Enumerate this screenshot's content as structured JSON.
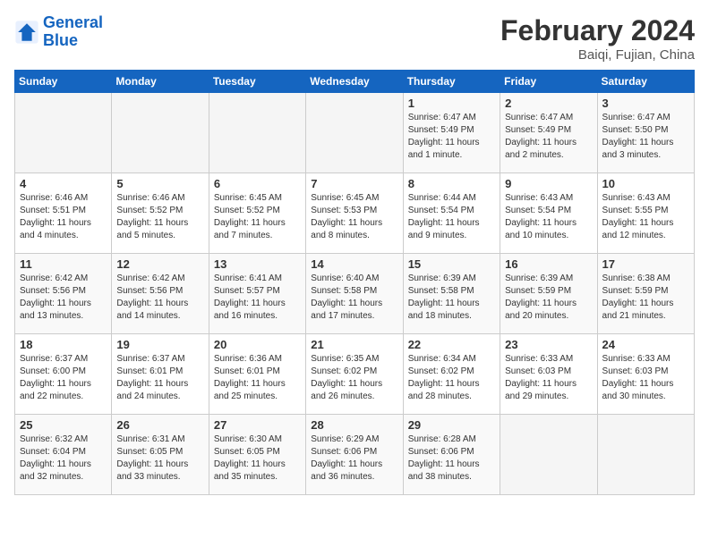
{
  "header": {
    "logo_line1": "General",
    "logo_line2": "Blue",
    "month_year": "February 2024",
    "location": "Baiqi, Fujian, China"
  },
  "days_of_week": [
    "Sunday",
    "Monday",
    "Tuesday",
    "Wednesday",
    "Thursday",
    "Friday",
    "Saturday"
  ],
  "weeks": [
    [
      {
        "day": "",
        "info": ""
      },
      {
        "day": "",
        "info": ""
      },
      {
        "day": "",
        "info": ""
      },
      {
        "day": "",
        "info": ""
      },
      {
        "day": "1",
        "info": "Sunrise: 6:47 AM\nSunset: 5:49 PM\nDaylight: 11 hours\nand 1 minute."
      },
      {
        "day": "2",
        "info": "Sunrise: 6:47 AM\nSunset: 5:49 PM\nDaylight: 11 hours\nand 2 minutes."
      },
      {
        "day": "3",
        "info": "Sunrise: 6:47 AM\nSunset: 5:50 PM\nDaylight: 11 hours\nand 3 minutes."
      }
    ],
    [
      {
        "day": "4",
        "info": "Sunrise: 6:46 AM\nSunset: 5:51 PM\nDaylight: 11 hours\nand 4 minutes."
      },
      {
        "day": "5",
        "info": "Sunrise: 6:46 AM\nSunset: 5:52 PM\nDaylight: 11 hours\nand 5 minutes."
      },
      {
        "day": "6",
        "info": "Sunrise: 6:45 AM\nSunset: 5:52 PM\nDaylight: 11 hours\nand 7 minutes."
      },
      {
        "day": "7",
        "info": "Sunrise: 6:45 AM\nSunset: 5:53 PM\nDaylight: 11 hours\nand 8 minutes."
      },
      {
        "day": "8",
        "info": "Sunrise: 6:44 AM\nSunset: 5:54 PM\nDaylight: 11 hours\nand 9 minutes."
      },
      {
        "day": "9",
        "info": "Sunrise: 6:43 AM\nSunset: 5:54 PM\nDaylight: 11 hours\nand 10 minutes."
      },
      {
        "day": "10",
        "info": "Sunrise: 6:43 AM\nSunset: 5:55 PM\nDaylight: 11 hours\nand 12 minutes."
      }
    ],
    [
      {
        "day": "11",
        "info": "Sunrise: 6:42 AM\nSunset: 5:56 PM\nDaylight: 11 hours\nand 13 minutes."
      },
      {
        "day": "12",
        "info": "Sunrise: 6:42 AM\nSunset: 5:56 PM\nDaylight: 11 hours\nand 14 minutes."
      },
      {
        "day": "13",
        "info": "Sunrise: 6:41 AM\nSunset: 5:57 PM\nDaylight: 11 hours\nand 16 minutes."
      },
      {
        "day": "14",
        "info": "Sunrise: 6:40 AM\nSunset: 5:58 PM\nDaylight: 11 hours\nand 17 minutes."
      },
      {
        "day": "15",
        "info": "Sunrise: 6:39 AM\nSunset: 5:58 PM\nDaylight: 11 hours\nand 18 minutes."
      },
      {
        "day": "16",
        "info": "Sunrise: 6:39 AM\nSunset: 5:59 PM\nDaylight: 11 hours\nand 20 minutes."
      },
      {
        "day": "17",
        "info": "Sunrise: 6:38 AM\nSunset: 5:59 PM\nDaylight: 11 hours\nand 21 minutes."
      }
    ],
    [
      {
        "day": "18",
        "info": "Sunrise: 6:37 AM\nSunset: 6:00 PM\nDaylight: 11 hours\nand 22 minutes."
      },
      {
        "day": "19",
        "info": "Sunrise: 6:37 AM\nSunset: 6:01 PM\nDaylight: 11 hours\nand 24 minutes."
      },
      {
        "day": "20",
        "info": "Sunrise: 6:36 AM\nSunset: 6:01 PM\nDaylight: 11 hours\nand 25 minutes."
      },
      {
        "day": "21",
        "info": "Sunrise: 6:35 AM\nSunset: 6:02 PM\nDaylight: 11 hours\nand 26 minutes."
      },
      {
        "day": "22",
        "info": "Sunrise: 6:34 AM\nSunset: 6:02 PM\nDaylight: 11 hours\nand 28 minutes."
      },
      {
        "day": "23",
        "info": "Sunrise: 6:33 AM\nSunset: 6:03 PM\nDaylight: 11 hours\nand 29 minutes."
      },
      {
        "day": "24",
        "info": "Sunrise: 6:33 AM\nSunset: 6:03 PM\nDaylight: 11 hours\nand 30 minutes."
      }
    ],
    [
      {
        "day": "25",
        "info": "Sunrise: 6:32 AM\nSunset: 6:04 PM\nDaylight: 11 hours\nand 32 minutes."
      },
      {
        "day": "26",
        "info": "Sunrise: 6:31 AM\nSunset: 6:05 PM\nDaylight: 11 hours\nand 33 minutes."
      },
      {
        "day": "27",
        "info": "Sunrise: 6:30 AM\nSunset: 6:05 PM\nDaylight: 11 hours\nand 35 minutes."
      },
      {
        "day": "28",
        "info": "Sunrise: 6:29 AM\nSunset: 6:06 PM\nDaylight: 11 hours\nand 36 minutes."
      },
      {
        "day": "29",
        "info": "Sunrise: 6:28 AM\nSunset: 6:06 PM\nDaylight: 11 hours\nand 38 minutes."
      },
      {
        "day": "",
        "info": ""
      },
      {
        "day": "",
        "info": ""
      }
    ]
  ]
}
